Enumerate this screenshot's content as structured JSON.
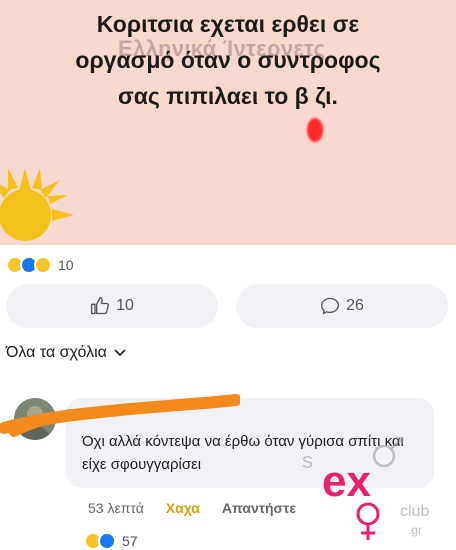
{
  "meme": {
    "lines": [
      "Κοριτσια εχεται ερθει σε",
      "οργασμό όταν ο συντροφος",
      "σας πιπιλαει το β  ζι."
    ],
    "watermark": "Ελληνικά Ίντερνετς"
  },
  "post_reactions": {
    "count": "10",
    "icons": [
      "haha-icon",
      "like-icon",
      "wow-icon"
    ]
  },
  "actions": {
    "like_count": "10",
    "comment_count": "26"
  },
  "comments_filter": {
    "label": "Όλα τα σχόλια"
  },
  "comment": {
    "text": "Όχι αλλά κόντεψα να έρθω όταν γύρισα σπίτι και είχε σφουγγαρίσει",
    "time": "53 λεπτά",
    "haha_label": "Χαχα",
    "reply_label": "Απαντήστε",
    "reaction_count": "57"
  },
  "logo": {
    "text": "sex club .gr"
  },
  "colors": {
    "meme_bg": "#f7d8cf",
    "accent_orange": "#f28a1c",
    "logo_pink": "#e8206f",
    "haha_gold": "#d4a20c"
  }
}
